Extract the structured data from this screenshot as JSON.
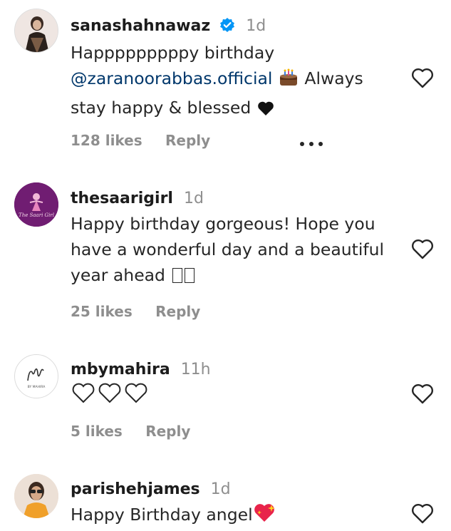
{
  "comments": [
    {
      "username": "sanashahnawaz",
      "time": "1d",
      "text_line1": "Happpppppppy birthday",
      "mention": "@zaranoorabbas.official",
      "text_after_mention": "Always",
      "text_line3": "stay happy & blessed",
      "likes": "128 likes",
      "reply": "Reply",
      "more_label": "•••"
    },
    {
      "username": "thesaarigirl",
      "time": "1d",
      "text": "Happy birthday gorgeous! Hope you have a wonderful day and a beautiful year ahead",
      "likes": "25 likes",
      "reply": "Reply"
    },
    {
      "username": "mbymahira",
      "time": "11h",
      "likes": "5 likes",
      "reply": "Reply",
      "avatar_text": "BY MAHIRA"
    },
    {
      "username": "parishehjames",
      "time": "1d",
      "text": "Happy Birthday angel"
    }
  ],
  "colors": {
    "username": "#1c1c1c",
    "muted": "#8e8e8e",
    "mention": "#00376b",
    "verified": "#0095f6"
  },
  "icons": [
    "verified-badge-icon",
    "heart-outline-icon",
    "more-options-icon",
    "birthday-cake-emoji",
    "black-heart-emoji",
    "white-heart-emoji",
    "sparkling-heart-emoji"
  ]
}
